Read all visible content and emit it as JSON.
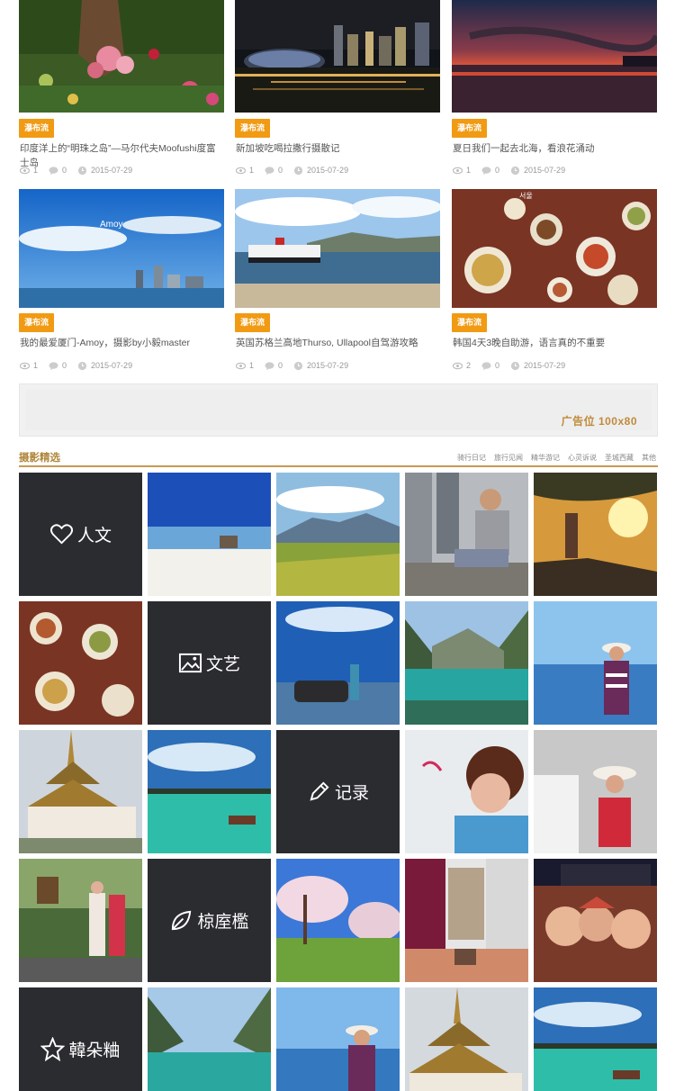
{
  "cards": [
    {
      "tag": "瀑布流",
      "title": "印度洋上的“明珠之岛”—马尔代夫Moofushi度富士岛",
      "views": "1",
      "comments": "0",
      "date": "2015-07-29"
    },
    {
      "tag": "瀑布流",
      "title": "新加坡吃喝拉撒行摄散记",
      "views": "1",
      "comments": "0",
      "date": "2015-07-29"
    },
    {
      "tag": "瀑布流",
      "title": "夏日我们一起去北海，看浪花涌动",
      "views": "1",
      "comments": "0",
      "date": "2015-07-29"
    },
    {
      "tag": "瀑布流",
      "title": "我的最爱厦门-Amoy，摄影by小毅master",
      "views": "1",
      "comments": "0",
      "date": "2015-07-29"
    },
    {
      "tag": "瀑布流",
      "title": "英国苏格兰高地Thurso, Ullapool自驾游攻略",
      "views": "1",
      "comments": "0",
      "date": "2015-07-29"
    },
    {
      "tag": "瀑布流",
      "title": "韩国4天3晚自助游，语言真的不重要",
      "views": "2",
      "comments": "0",
      "date": "2015-07-29"
    }
  ],
  "ad": {
    "label": "广告位 100x80"
  },
  "section": {
    "title": "摄影精选",
    "nav": [
      "骑行日记",
      "旅行见闻",
      "精华游记",
      "心灵诉说",
      "圣城西藏",
      "其他"
    ]
  },
  "categories": [
    {
      "label": "人文",
      "icon": "heart-icon"
    },
    {
      "label": "文艺",
      "icon": "image-icon"
    },
    {
      "label": "记录",
      "icon": "pencil-icon"
    },
    {
      "label": "椋庢檻",
      "icon": "leaf-icon"
    },
    {
      "label": "韓朵粬",
      "icon": "star-icon"
    }
  ],
  "colors": {
    "accent": "#f19a13",
    "section_line": "#c79a54",
    "tile_dark": "#2b2c30"
  }
}
